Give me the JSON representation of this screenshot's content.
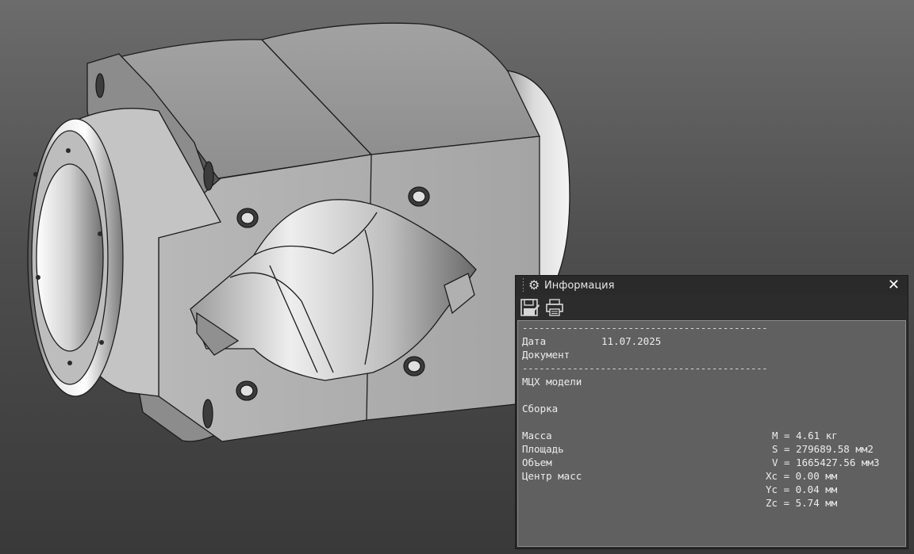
{
  "panel": {
    "title": "Информация",
    "close_label": "✕",
    "toolbar": {
      "save_icon": "save-icon",
      "print_icon": "print-icon"
    }
  },
  "report": {
    "separator": "--------------------------------------------",
    "date_label": "Дата",
    "date_value": "11.07.2025",
    "document_label": "Документ",
    "section_title": "МЦХ модели",
    "assembly_label": "Сборка",
    "mass_label": "Масса",
    "mass_value": "M = 4.61 кг",
    "area_label": "Площадь",
    "area_value": "S = 279689.58 мм2",
    "volume_label": "Объем",
    "volume_value": "V = 1665427.56 мм3",
    "center_label": "Центр масс",
    "xc_value": "Xc = 0.00 мм",
    "yc_value": "Yc = 0.04 мм",
    "zc_value": "Zc = 5.74 мм"
  },
  "colors": {
    "viewport_top": "#6c6c6c",
    "viewport_bottom": "#393939",
    "panel_content": "#606060"
  }
}
